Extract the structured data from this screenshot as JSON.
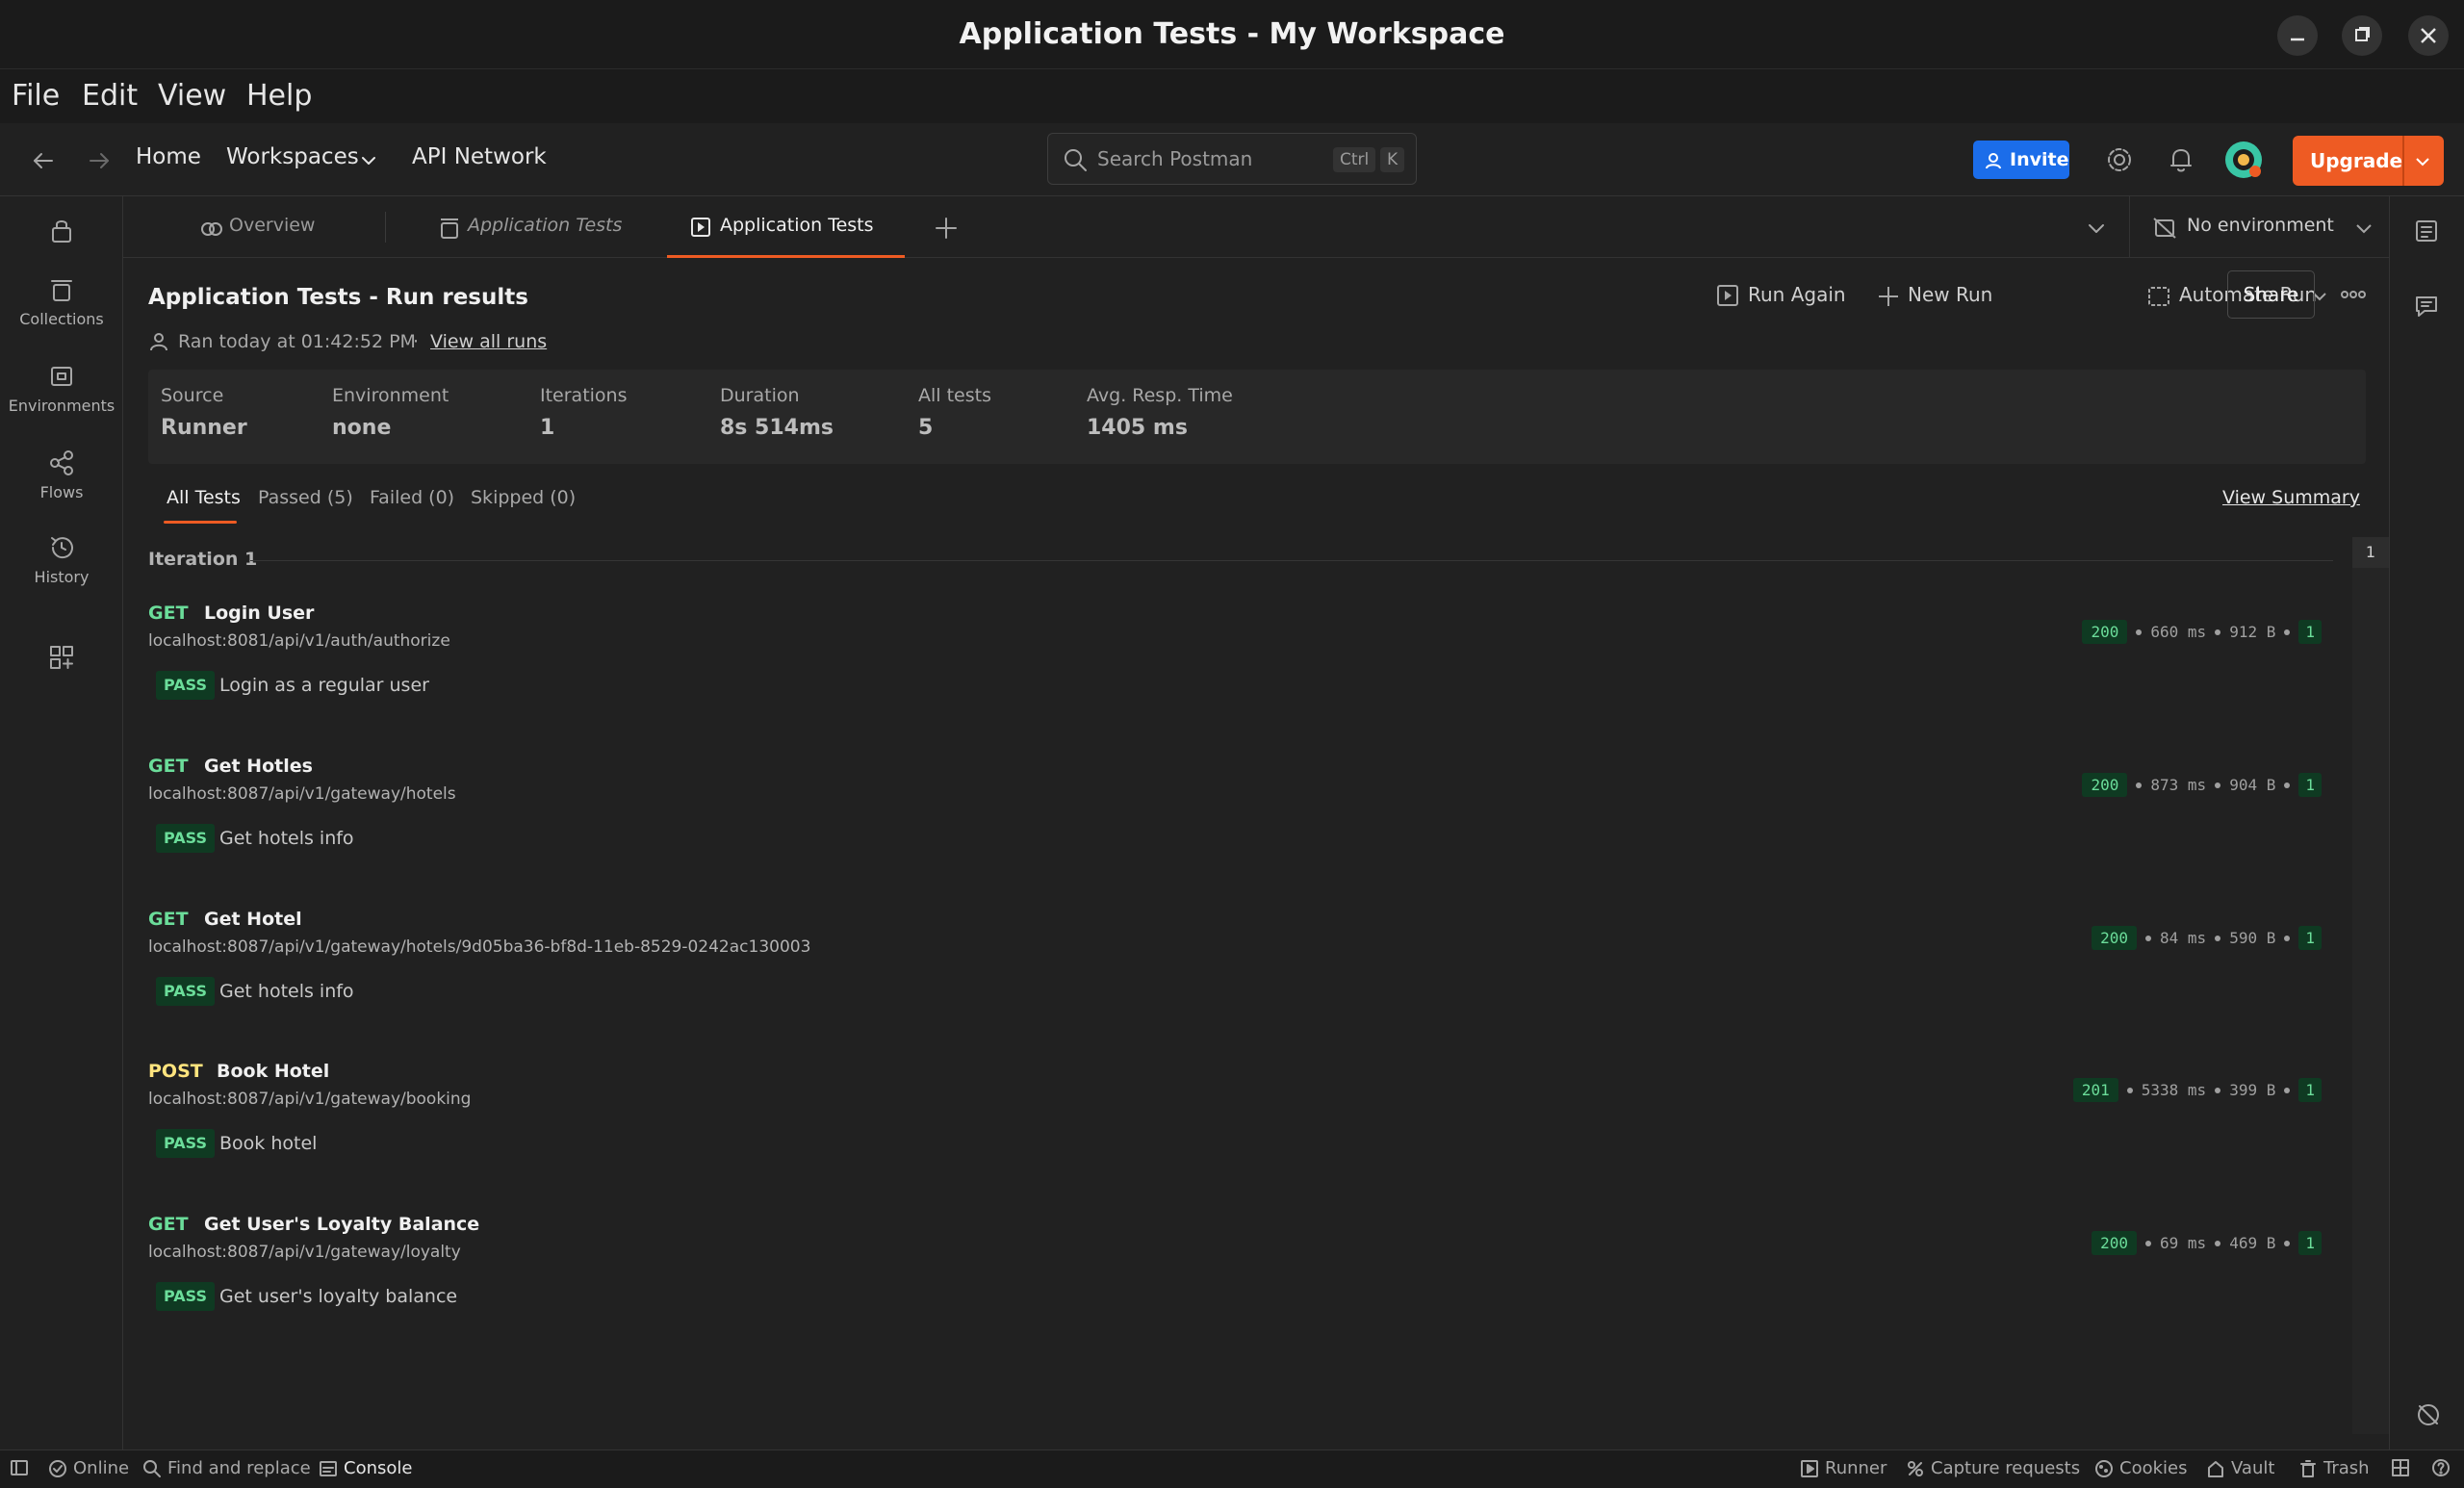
{
  "window": {
    "title": "Application Tests - My Workspace"
  },
  "menu": [
    "File",
    "Edit",
    "View",
    "Help"
  ],
  "header": {
    "home": "Home",
    "workspaces": "Workspaces",
    "api_network": "API Network",
    "search_placeholder": "Search Postman",
    "shortcut_ctrl": "Ctrl",
    "shortcut_key": "K",
    "invite": "Invite",
    "upgrade": "Upgrade"
  },
  "sidebar": {
    "items": [
      {
        "label": "Collections"
      },
      {
        "label": "Environments"
      },
      {
        "label": "Flows"
      },
      {
        "label": "History"
      }
    ]
  },
  "tabs": [
    {
      "label": "Overview"
    },
    {
      "label": "Application Tests"
    },
    {
      "label": "Application Tests"
    }
  ],
  "environment": {
    "selected": "No environment"
  },
  "run": {
    "title": "Application Tests - Run results",
    "ran_at": "Ran today at 01:42:52 PM",
    "view_all_runs": "View all runs",
    "actions": {
      "run_again": "Run Again",
      "new_run": "New Run",
      "automate_run": "Automate Run",
      "share": "Share"
    },
    "stats": [
      {
        "label": "Source",
        "value": "Runner"
      },
      {
        "label": "Environment",
        "value": "none"
      },
      {
        "label": "Iterations",
        "value": "1"
      },
      {
        "label": "Duration",
        "value": "8s 514ms"
      },
      {
        "label": "All tests",
        "value": "5"
      },
      {
        "label": "Avg. Resp. Time",
        "value": "1405 ms"
      }
    ],
    "filters": [
      "All Tests",
      "Passed (5)",
      "Failed (0)",
      "Skipped (0)"
    ],
    "view_summary": "View Summary",
    "iteration_label": "Iteration 1",
    "page": "1",
    "requests": [
      {
        "method": "GET",
        "name": "Login User",
        "url": "localhost:8081/api/v1/auth/authorize",
        "status": "200",
        "time": "660 ms",
        "size": "912 B",
        "count": "1",
        "result": "PASS",
        "test": "Login as a regular user"
      },
      {
        "method": "GET",
        "name": "Get Hotles",
        "url": "localhost:8087/api/v1/gateway/hotels",
        "status": "200",
        "time": "873 ms",
        "size": "904 B",
        "count": "1",
        "result": "PASS",
        "test": "Get hotels info"
      },
      {
        "method": "GET",
        "name": "Get Hotel",
        "url": "localhost:8087/api/v1/gateway/hotels/9d05ba36-bf8d-11eb-8529-0242ac130003",
        "status": "200",
        "time": "84 ms",
        "size": "590 B",
        "count": "1",
        "result": "PASS",
        "test": "Get hotels info"
      },
      {
        "method": "POST",
        "name": "Book Hotel",
        "url": "localhost:8087/api/v1/gateway/booking",
        "status": "201",
        "time": "5338 ms",
        "size": "399 B",
        "count": "1",
        "result": "PASS",
        "test": "Book hotel"
      },
      {
        "method": "GET",
        "name": "Get User's Loyalty Balance",
        "url": "localhost:8087/api/v1/gateway/loyalty",
        "status": "200",
        "time": "69 ms",
        "size": "469 B",
        "count": "1",
        "result": "PASS",
        "test": "Get user's loyalty balance"
      }
    ]
  },
  "statusbar": {
    "online": "Online",
    "find_replace": "Find and replace",
    "console": "Console",
    "runner": "Runner",
    "capture": "Capture requests",
    "cookies": "Cookies",
    "vault": "Vault",
    "trash": "Trash"
  },
  "colors": {
    "accent": "#ee5b23",
    "invite": "#1b6dea",
    "get": "#6bdd9a",
    "post": "#ffe47e",
    "pass_bg": "#0f3a22"
  }
}
